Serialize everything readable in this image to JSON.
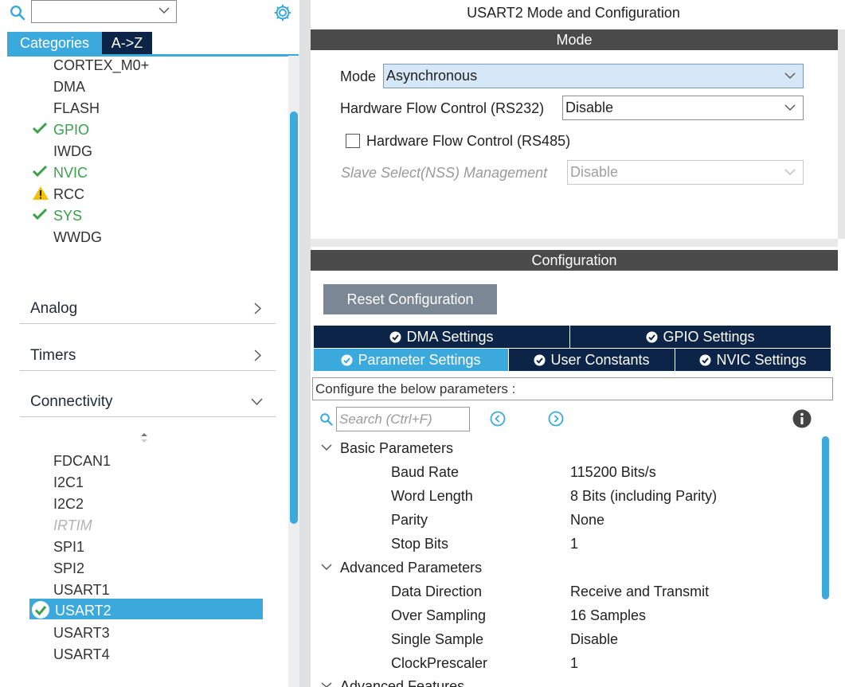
{
  "left": {
    "search": {
      "value": ""
    },
    "tabs": [
      {
        "label": "Categories",
        "active": true
      },
      {
        "label": "A->Z",
        "active": false
      }
    ],
    "system_core_items": [
      {
        "label": "CORTEX_M0+",
        "status": "none"
      },
      {
        "label": "DMA",
        "status": "none"
      },
      {
        "label": "FLASH",
        "status": "none"
      },
      {
        "label": "GPIO",
        "status": "ok"
      },
      {
        "label": "IWDG",
        "status": "none"
      },
      {
        "label": "NVIC",
        "status": "ok"
      },
      {
        "label": "RCC",
        "status": "warning"
      },
      {
        "label": "SYS",
        "status": "ok"
      },
      {
        "label": "WWDG",
        "status": "none"
      }
    ],
    "sections": [
      {
        "label": "Analog",
        "expanded": false
      },
      {
        "label": "Timers",
        "expanded": false
      },
      {
        "label": "Connectivity",
        "expanded": true
      }
    ],
    "connectivity_items": [
      {
        "label": "FDCAN1",
        "status": "none"
      },
      {
        "label": "I2C1",
        "status": "none"
      },
      {
        "label": "I2C2",
        "status": "none"
      },
      {
        "label": "IRTIM",
        "status": "disabled"
      },
      {
        "label": "SPI1",
        "status": "none"
      },
      {
        "label": "SPI2",
        "status": "none"
      },
      {
        "label": "USART1",
        "status": "none"
      },
      {
        "label": "USART2",
        "status": "selected"
      },
      {
        "label": "USART3",
        "status": "none"
      },
      {
        "label": "USART4",
        "status": "none"
      }
    ]
  },
  "right": {
    "title": "USART2 Mode and Configuration",
    "mode_section": {
      "header": "Mode",
      "fields": [
        {
          "label": "Mode",
          "value": "Asynchronous"
        },
        {
          "label": "Hardware Flow Control (RS232)",
          "value": "Disable"
        },
        {
          "label": "Slave Select(NSS) Management",
          "value": "Disable"
        }
      ],
      "rs485_checkbox": {
        "label": "Hardware Flow Control (RS485)",
        "checked": false
      }
    },
    "config_section": {
      "header": "Configuration",
      "reset_button": "Reset Configuration",
      "tabs_row1": [
        {
          "label": "DMA Settings",
          "active": false
        },
        {
          "label": "GPIO Settings",
          "active": false
        }
      ],
      "tabs_row2": [
        {
          "label": "Parameter Settings",
          "active": true
        },
        {
          "label": "User Constants",
          "active": false
        },
        {
          "label": "NVIC Settings",
          "active": false
        }
      ],
      "description": "Configure the below parameters :",
      "search_placeholder": "Search (Ctrl+F)",
      "groups": [
        {
          "name": "Basic Parameters",
          "params": [
            {
              "name": "Baud Rate",
              "value": "115200 Bits/s"
            },
            {
              "name": "Word Length",
              "value": "8 Bits (including Parity)"
            },
            {
              "name": "Parity",
              "value": "None"
            },
            {
              "name": "Stop Bits",
              "value": "1"
            }
          ]
        },
        {
          "name": "Advanced Parameters",
          "params": [
            {
              "name": "Data Direction",
              "value": "Receive and Transmit"
            },
            {
              "name": "Over Sampling",
              "value": "16 Samples"
            },
            {
              "name": "Single Sample",
              "value": "Disable"
            },
            {
              "name": "ClockPrescaler",
              "value": "1"
            }
          ]
        },
        {
          "name": "Advanced Features",
          "params": []
        }
      ]
    }
  },
  "colors": {
    "accent": "#3ca9dd",
    "navy": "#0b2447",
    "ok": "#3aa14a",
    "warning": "#f2c200",
    "header_bar": "#4a4a4a"
  },
  "icons": [
    "search-icon",
    "gear-icon",
    "check-icon",
    "warning-icon",
    "chevron-right-icon",
    "chevron-down-icon",
    "prev-icon",
    "next-icon",
    "info-icon"
  ]
}
